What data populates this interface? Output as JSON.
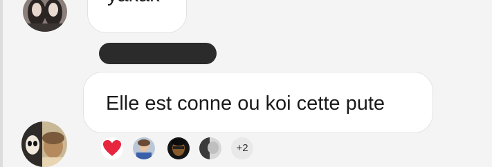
{
  "thread": {
    "messages": [
      {
        "text": "yakak"
      },
      {
        "text": "Elle est conne ou koi cette pute"
      }
    ],
    "reactions": {
      "icons": [
        "heart-icon",
        "reactor-avatar",
        "reactor-avatar",
        "reactor-avatar"
      ],
      "more_count": "+2"
    }
  },
  "colors": {
    "background": "#f4f4f4",
    "bubble": "#ffffff",
    "redaction": "#2b2b2b",
    "heart": "#e8253f"
  }
}
